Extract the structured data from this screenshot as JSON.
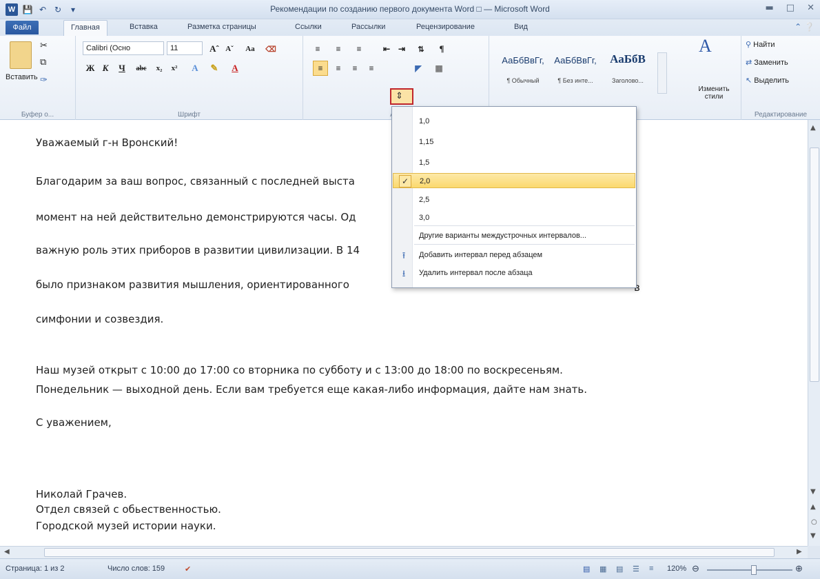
{
  "window": {
    "title": "Рекомендации по созданию первого документа Word",
    "title_suffix": "— Microsoft Word",
    "app_icon_letter": "W"
  },
  "tabs": {
    "file": "Файл",
    "items": [
      "Главная",
      "Вставка",
      "Разметка страницы",
      "Ссылки",
      "Рассылки",
      "Рецензирование",
      "Вид"
    ]
  },
  "ribbon": {
    "clipboard": {
      "paste_label": "Вставить",
      "group_label": "Буфер о..."
    },
    "font": {
      "font_name": "Calibri (Осно",
      "font_size": "11",
      "group_label": "Шрифт"
    },
    "paragraph": {
      "group_label": "Абз"
    },
    "styles": {
      "items": [
        {
          "sample": "АаБбВвГг,",
          "name": "¶ Обычный"
        },
        {
          "sample": "АаБбВвГг,",
          "name": "¶ Без инте..."
        },
        {
          "sample": "АаБбВ",
          "name": "Заголово..."
        }
      ],
      "change_styles": "Изменить стили",
      "group_label": "Стили"
    },
    "editing": {
      "find": "Найти",
      "replace": "Заменить",
      "select": "Выделить",
      "group_label": "Редактирование"
    }
  },
  "menu": {
    "items": [
      "1,0",
      "1,15",
      "1,5",
      "2,0",
      "2,5",
      "3,0"
    ],
    "selected_index": 3,
    "more": "Другие варианты междустрочных интервалов...",
    "add_before": "Добавить интервал перед абзацем",
    "remove_after": "Удалить интервал после абзаца"
  },
  "document": {
    "lines": [
      "Уважаемый г-н Вронский!",
      "Благодарим за ваш вопрос, связанный с последней выста",
      "момент на ней действительно демонстрируются часы. Од",
      "важную роль этих приборов в развитии цивилизации. В 14",
      "было признаком развития мышления, ориентированного",
      "симфонии и созвездия.",
      "Наш музей открыт с 10:00 до 17:00 со вторника по субботу и с 13:00 до 18:00 по воскресеньям.",
      "Понедельник — выходной день. Если вам требуется еще какая-либо информация, дайте нам знать.",
      "С уважением,",
      "Николай Грачев.",
      "Отдел связей с обьественностью.",
      "Городской музей истории науки."
    ],
    "overflow_char": "в"
  },
  "status": {
    "page": "Страница: 1 из 2",
    "words": "Число слов: 159",
    "zoom": "120%"
  }
}
